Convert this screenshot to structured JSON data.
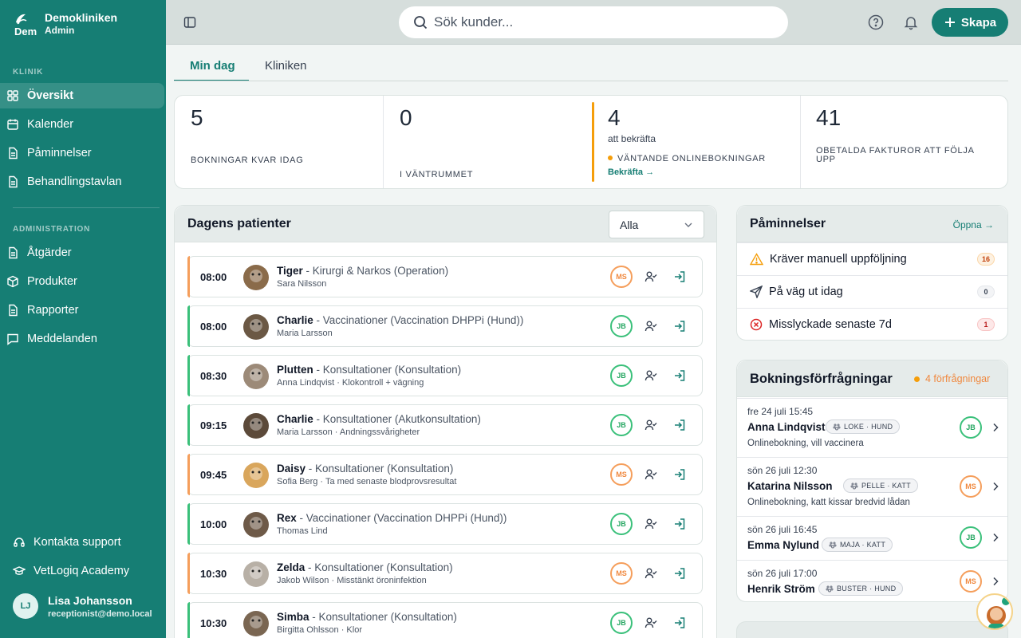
{
  "sidebar": {
    "brand_name": "Demokliniken",
    "brand_role": "Admin",
    "brand_logo_text": "Dem",
    "section_clinic": "KLINIK",
    "clinic_items": [
      "Översikt",
      "Kalender",
      "Påminnelser",
      "Behandlingstavlan"
    ],
    "section_admin": "ADMINISTRATION",
    "admin_items": [
      "Åtgärder",
      "Produkter",
      "Rapporter",
      "Meddelanden"
    ],
    "support": "Kontakta support",
    "academy": "VetLogiq Academy",
    "user_initials": "LJ",
    "user_name": "Lisa Johansson",
    "user_email": "receptionist@demo.local"
  },
  "topbar": {
    "search_placeholder": "Sök kunder...",
    "create_label": "Skapa"
  },
  "tabs": [
    "Min dag",
    "Kliniken"
  ],
  "stats": {
    "bookings_left": "5",
    "bookings_left_label": "BOKNINGAR KVAR IDAG",
    "waiting": "0",
    "waiting_label": "I VÄNTRUMMET",
    "to_confirm": "4",
    "to_confirm_sub": "att bekräfta",
    "to_confirm_label": "VÄNTANDE ONLINEBOKNINGAR",
    "confirm_link": "Bekräfta →",
    "unpaid": "41",
    "unpaid_label": "OBETALDA FAKTUROR ATT FÖLJA UPP"
  },
  "patients": {
    "title": "Dagens patienter",
    "filter": "Alla",
    "rows": [
      {
        "time": "08:00",
        "name": "Tiger",
        "desc": " - Kirurgi & Narkos (Operation)",
        "sub": "Sara Nilsson",
        "staff": "MS"
      },
      {
        "time": "08:00",
        "name": "Charlie",
        "desc": " - Vaccinationer (Vaccination DHPPi (Hund))",
        "sub": "Maria Larsson",
        "staff": "JB"
      },
      {
        "time": "08:30",
        "name": "Plutten",
        "desc": " - Konsultationer (Konsultation)",
        "sub": "Anna Lindqvist · Klokontroll + vägning",
        "staff": "JB"
      },
      {
        "time": "09:15",
        "name": "Charlie",
        "desc": " - Konsultationer (Akutkonsultation)",
        "sub": "Maria Larsson · Andningssvårigheter",
        "staff": "JB"
      },
      {
        "time": "09:45",
        "name": "Daisy",
        "desc": " - Konsultationer (Konsultation)",
        "sub": "Sofia Berg · Ta med senaste blodprovsresultat",
        "staff": "MS"
      },
      {
        "time": "10:00",
        "name": "Rex",
        "desc": " - Vaccinationer (Vaccination DHPPi (Hund))",
        "sub": "Thomas Lind",
        "staff": "JB"
      },
      {
        "time": "10:30",
        "name": "Zelda",
        "desc": " - Konsultationer (Konsultation)",
        "sub": "Jakob Wilson · Misstänkt öroninfektion",
        "staff": "MS"
      },
      {
        "time": "10:30",
        "name": "Simba",
        "desc": " - Konsultationer (Konsultation)",
        "sub": "Birgitta Ohlsson · Klor",
        "staff": "JB"
      }
    ]
  },
  "reminders": {
    "title": "Påminnelser",
    "open_link": "Öppna →",
    "items": [
      {
        "label": "Kräver manuell uppföljning",
        "count": "16"
      },
      {
        "label": "På väg ut idag",
        "count": "0"
      },
      {
        "label": "Misslyckade senaste 7d",
        "count": "1"
      }
    ]
  },
  "requests": {
    "title": "Bokningsförfrågningar",
    "count_label": "4 förfrågningar",
    "items": [
      {
        "date": "fre 24 juli 15:45",
        "name": "Anna Lindqvist",
        "tag": "LOKE · HUND",
        "note": "Onlinebokning, vill vaccinera",
        "staff": "JB"
      },
      {
        "date": "sön 26 juli 12:30",
        "name": "Katarina Nilsson",
        "tag": "PELLE · KATT",
        "note": "Onlinebokning, katt kissar bredvid lådan",
        "staff": "MS"
      },
      {
        "date": "sön 26 juli 16:45",
        "name": "Emma Nylund",
        "tag": "MAJA · KATT",
        "note": "",
        "staff": "JB"
      },
      {
        "date": "sön 26 juli 17:00",
        "name": "Henrik Ström",
        "tag": "BUSTER · HUND",
        "note": "",
        "staff": "MS"
      }
    ]
  },
  "colors": {
    "brand": "#167e74",
    "accent_orange": "#f59e0b",
    "success_green": "#22a55f"
  }
}
